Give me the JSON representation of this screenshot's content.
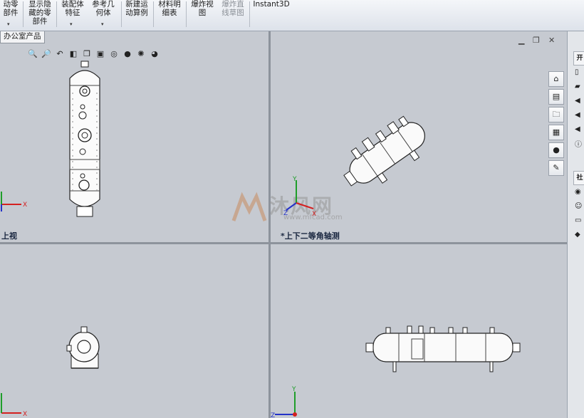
{
  "toolbar": {
    "items": [
      {
        "line1": "动零",
        "line2": "部件",
        "dim": false
      },
      {
        "line1": "显示隐",
        "line2": "藏的零",
        "line3": "部件",
        "dim": false
      },
      {
        "line1": "装配体",
        "line2": "特征",
        "dim": false
      },
      {
        "line1": "参考几",
        "line2": "何体",
        "dim": false
      },
      {
        "line1": "新建运",
        "line2": "动算例",
        "dim": false
      },
      {
        "line1": "材料明",
        "line2": "细表",
        "dim": false
      },
      {
        "line1": "爆炸视",
        "line2": "图",
        "dim": false
      },
      {
        "line1": "爆炸直",
        "line2": "线草图",
        "dim": true
      },
      {
        "line1": "Instant3D",
        "line2": "",
        "dim": false
      }
    ]
  },
  "tree_tab_label": "办公室产品",
  "views": {
    "top": "上视",
    "iso": "*上下二等角轴测",
    "bottom_left": "",
    "bottom_right": ""
  },
  "axes": {
    "x": "X",
    "y": "Y",
    "z": "Z"
  },
  "watermark": {
    "brand": "沐风网",
    "url": "www.mfcad.com"
  },
  "right_panel_tabs": [
    "开",
    "社"
  ],
  "colors": {
    "viewport_bg": "#c6cad1",
    "accent": "#e0652a",
    "axis_x": "#d42020",
    "axis_y": "#1f9e2a",
    "axis_z": "#2432c8"
  }
}
